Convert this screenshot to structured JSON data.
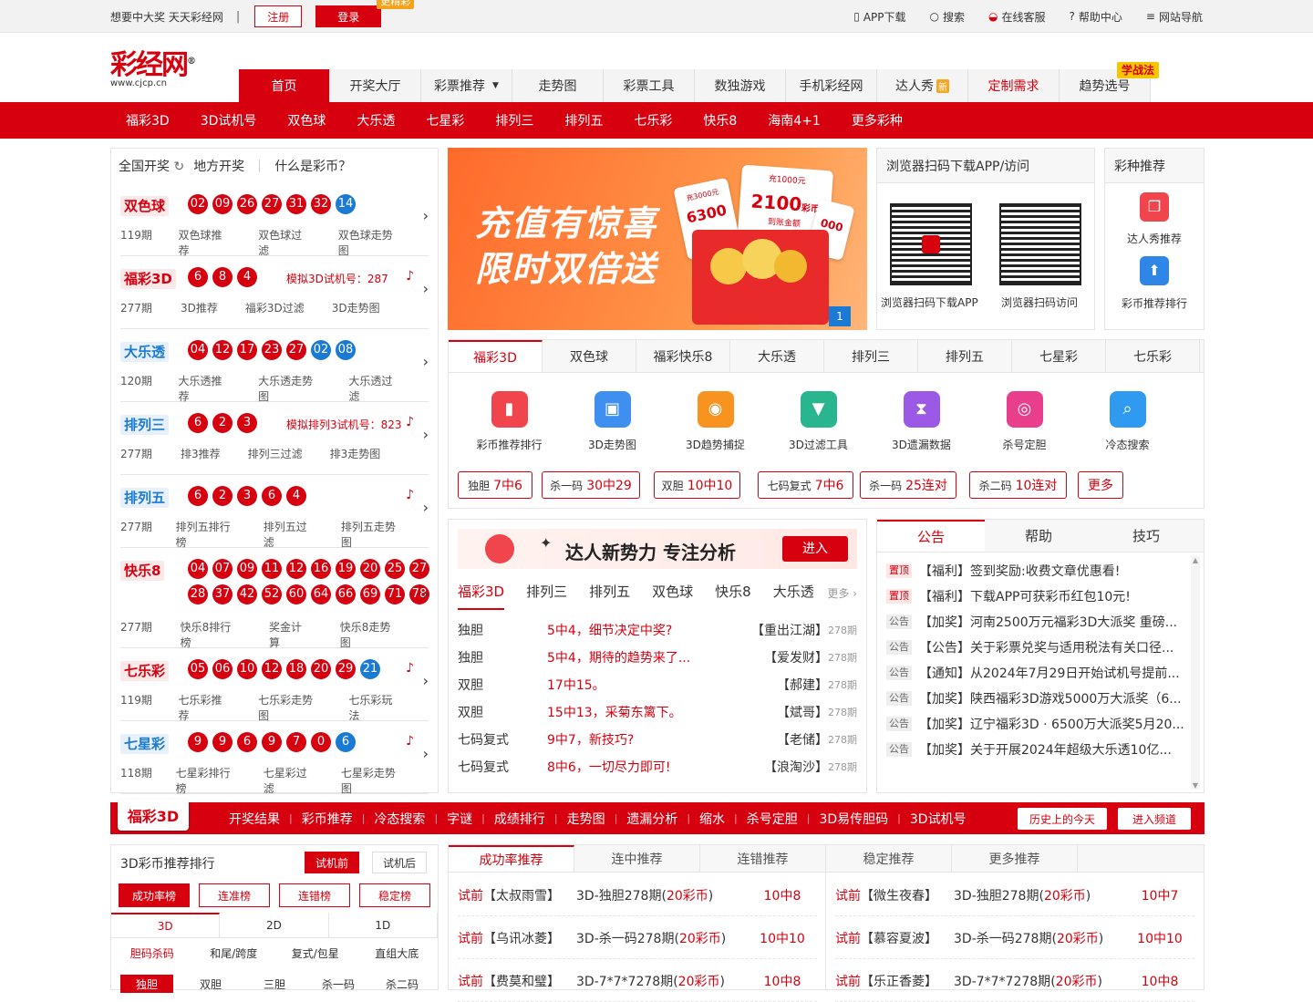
{
  "topbar": {
    "slogan": "想要中大奖 天天彩经网",
    "sep": "|",
    "register": "注册",
    "login": "登录",
    "login_tag": "更精彩",
    "links": [
      "APP下载",
      "搜索",
      "在线客服",
      "帮助中心",
      "网站导航"
    ]
  },
  "logo": {
    "text": "彩经网",
    "url": "www.cjcp.cn",
    "reg": "®"
  },
  "mainnav": [
    {
      "label": "首页"
    },
    {
      "label": "开奖大厅"
    },
    {
      "label": "彩票推荐"
    },
    {
      "label": "走势图"
    },
    {
      "label": "彩票工具"
    },
    {
      "label": "数独游戏"
    },
    {
      "label": "手机彩经网"
    },
    {
      "label": "达人秀"
    },
    {
      "label": "定制需求"
    },
    {
      "label": "趋势选号"
    }
  ],
  "mainnav_badges": {
    "new": "新",
    "xuezhan": "学战法"
  },
  "subnav": [
    "福彩3D",
    "3D试机号",
    "双色球",
    "大乐透",
    "七星彩",
    "排列三",
    "排列五",
    "七乐彩",
    "快乐8",
    "海南4+1",
    "更多彩种"
  ],
  "lottery_panel": {
    "tabs": [
      "全国开奖",
      "地方开奖",
      "什么是彩币？"
    ],
    "items": [
      {
        "name": "双色球",
        "issue": "119期",
        "red": [
          "02",
          "09",
          "26",
          "27",
          "31",
          "32"
        ],
        "blue": [
          "14"
        ],
        "links": [
          "双色球推荐",
          "双色球过滤",
          "双色球走势图"
        ]
      },
      {
        "name": "福彩3D",
        "issue": "277期",
        "red": [
          "6",
          "8",
          "4"
        ],
        "blue": [],
        "sim": "模拟3D试机号：287",
        "links": [
          "3D推荐",
          "福彩3D过滤",
          "3D走势图"
        ]
      },
      {
        "name": "大乐透",
        "issue": "120期",
        "red": [
          "04",
          "12",
          "17",
          "23",
          "27"
        ],
        "blue": [
          "02",
          "08"
        ],
        "links": [
          "大乐透推荐",
          "大乐透走势图",
          "大乐透过滤"
        ]
      },
      {
        "name": "排列三",
        "issue": "277期",
        "red": [
          "6",
          "2",
          "3"
        ],
        "blue": [],
        "sim": "模拟排列3试机号：823",
        "links": [
          "排3推荐",
          "排列三过滤",
          "排3走势图"
        ]
      },
      {
        "name": "排列五",
        "issue": "277期",
        "red": [
          "6",
          "2",
          "3",
          "6",
          "4"
        ],
        "blue": [],
        "links": [
          "排列五排行榜",
          "排列五过滤",
          "排列五走势图"
        ]
      },
      {
        "name": "快乐8",
        "issue": "277期",
        "red": [
          "04",
          "07",
          "09",
          "11",
          "12",
          "16",
          "19",
          "20",
          "25",
          "27",
          "28",
          "37",
          "42",
          "52",
          "60",
          "64",
          "66",
          "69",
          "71",
          "78"
        ],
        "blue": [],
        "links": [
          "快乐8排行榜",
          "奖金计算",
          "快乐8走势图"
        ]
      },
      {
        "name": "七乐彩",
        "issue": "119期",
        "red": [
          "05",
          "06",
          "10",
          "12",
          "18",
          "20",
          "29"
        ],
        "blue": [
          "21"
        ],
        "links": [
          "七乐彩推荐",
          "七乐彩走势图",
          "七乐彩玩法"
        ]
      },
      {
        "name": "七星彩",
        "issue": "118期",
        "red": [
          "9",
          "9",
          "6",
          "9",
          "7",
          "0"
        ],
        "blue": [
          "6"
        ],
        "links": [
          "七星彩排行榜",
          "七星彩过滤",
          "七星彩走势图"
        ]
      }
    ]
  },
  "banner": {
    "line1": "充值有惊喜",
    "line2": "限时双倍送",
    "card1": "2100",
    "card1_unit": "彩币",
    "card1_top": "充1000元",
    "card1_sub": "到账金额",
    "card2": "6300",
    "card2_top": "充3000元",
    "card3": "000",
    "page": "1"
  },
  "qr": {
    "title": "浏览器扫码下载APP/访问",
    "labels": [
      "浏览器扫码下载APP",
      "浏览器扫码访问"
    ]
  },
  "recommend": {
    "title": "彩种推荐",
    "items": [
      "达人秀推荐",
      "彩币推荐排行"
    ]
  },
  "tools": {
    "tabs": [
      "福彩3D",
      "双色球",
      "福彩快乐8",
      "大乐透",
      "排列三",
      "排列五",
      "七星彩",
      "七乐彩"
    ],
    "items": [
      {
        "label": "彩币推荐排行",
        "color": "#f0454c"
      },
      {
        "label": "3D走势图",
        "color": "#3f8ff0"
      },
      {
        "label": "3D趋势捕捉",
        "color": "#f7931e"
      },
      {
        "label": "3D过滤工具",
        "color": "#29b58d"
      },
      {
        "label": "3D遗漏数据",
        "color": "#9b59e6"
      },
      {
        "label": "杀号定胆",
        "color": "#e83e8c"
      },
      {
        "label": "冷态搜索",
        "color": "#2f9af0"
      }
    ],
    "chips": [
      {
        "label": "独胆",
        "value": "7中6"
      },
      {
        "label": "杀一码",
        "value": "30中29"
      },
      {
        "label": "双胆",
        "value": "10中10"
      },
      {
        "label": "七码复式",
        "value": "7中6"
      },
      {
        "label": "杀一码",
        "value": "25连对"
      },
      {
        "label": "杀二码",
        "value": "10连对"
      },
      {
        "label": "",
        "value": "更多"
      }
    ]
  },
  "experts": {
    "banner": "达人新势力 专注分析",
    "enter": "进入",
    "tabs": [
      "福彩3D",
      "排列三",
      "排列五",
      "双色球",
      "快乐8",
      "大乐透"
    ],
    "more": "更多",
    "rows": [
      {
        "type": "独胆",
        "text": "5中4，细节决定中奖?",
        "author": "【重出江湖】",
        "issue": "278期"
      },
      {
        "type": "独胆",
        "text": "5中4，期待的趋势来了...",
        "author": "【爱发财】",
        "issue": "278期"
      },
      {
        "type": "双胆",
        "text": "17中15。",
        "author": "【郝建】",
        "issue": "278期"
      },
      {
        "type": "双胆",
        "text": "15中13，采菊东篱下。",
        "author": "【斌哥】",
        "issue": "278期"
      },
      {
        "type": "七码复式",
        "text": "9中7，新技巧?",
        "author": "【老储】",
        "issue": "278期"
      },
      {
        "type": "七码复式",
        "text": "8中6，一切尽力即可!",
        "author": "【浪淘沙】",
        "issue": "278期"
      }
    ]
  },
  "notices": {
    "tabs": [
      "公告",
      "帮助",
      "技巧"
    ],
    "rows": [
      {
        "tag": "置顶",
        "top": true,
        "text": "【福利】签到奖励:收费文章优惠看!"
      },
      {
        "tag": "置顶",
        "top": true,
        "text": "【福利】下载APP可获彩币红包10元!"
      },
      {
        "tag": "公告",
        "top": false,
        "text": "【加奖】河南2500万元福彩3D大派奖 重磅..."
      },
      {
        "tag": "公告",
        "top": false,
        "text": "【公告】关于彩票兑奖与适用税法有关口径..."
      },
      {
        "tag": "公告",
        "top": false,
        "text": "【通知】从2024年7月29日开始试机号提前..."
      },
      {
        "tag": "公告",
        "top": false,
        "text": "【加奖】陕西福彩3D游戏5000万大派奖（6..."
      },
      {
        "tag": "公告",
        "top": false,
        "text": "【加奖】辽宁福彩3D · 6500万大派奖5月20..."
      },
      {
        "tag": "公告",
        "top": false,
        "text": "【加奖】关于开展2024年超级大乐透10亿..."
      }
    ]
  },
  "channel": {
    "logo": "福彩3D",
    "links": [
      "开奖结果",
      "彩币推荐",
      "冷态搜索",
      "字谜",
      "成绩排行",
      "走势图",
      "遗漏分析",
      "缩水",
      "杀号定胆",
      "3D易传胆码",
      "3D试机号"
    ],
    "sep": "|",
    "btn_history": "历史上的今天",
    "btn_enter": "进入频道"
  },
  "rank": {
    "title": "3D彩币推荐排行",
    "btn_before": "试机前",
    "btn_after": "试机后",
    "tabs": [
      "成功率榜",
      "连准榜",
      "连错榜",
      "稳定榜"
    ],
    "dtabs": [
      "3D",
      "2D",
      "1D"
    ],
    "mtabs": [
      "胆码杀码",
      "和尾/跨度",
      "复式/包星",
      "直组大底"
    ],
    "stabs": [
      "独胆",
      "双胆",
      "三胆",
      "杀一码",
      "杀二码"
    ]
  },
  "recs": {
    "tabs": [
      "成功率推荐",
      "连中推荐",
      "连错推荐",
      "稳定推荐",
      "更多推荐"
    ],
    "left": [
      {
        "pre": "试前",
        "name": "【太叔雨雪】",
        "item": "3D-独胆278期",
        "coin": "20彩币",
        "hit": "10中8"
      },
      {
        "pre": "试前",
        "name": "【乌讯冰菱】",
        "item": "3D-杀一码278期",
        "coin": "20彩币",
        "hit": "10中10"
      },
      {
        "pre": "试前",
        "name": "【费莫和璧】",
        "item": "3D-7*7*7278期",
        "coin": "20彩币",
        "hit": "10中8"
      }
    ],
    "right": [
      {
        "pre": "试前",
        "name": "【微生夜春】",
        "item": "3D-独胆278期",
        "coin": "20彩币",
        "hit": "10中7"
      },
      {
        "pre": "试前",
        "name": "【慕容夏波】",
        "item": "3D-杀一码278期",
        "coin": "20彩币",
        "hit": "10中10"
      },
      {
        "pre": "试前",
        "name": "【乐正香菱】",
        "item": "3D-7*7*7278期",
        "coin": "20彩币",
        "hit": "10中8"
      }
    ]
  },
  "colors": {
    "brand_red": "#d7000f",
    "blue_ball": "#1a7ad4",
    "badge_orange": "#f7a21b"
  }
}
